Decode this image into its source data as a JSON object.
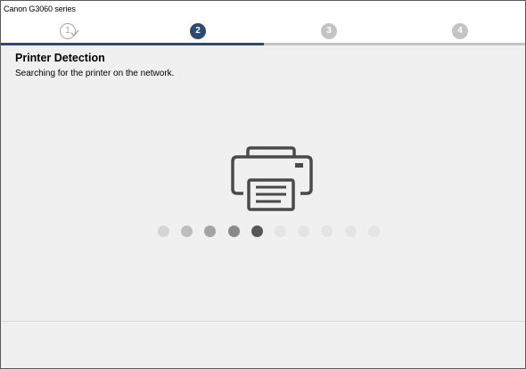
{
  "window": {
    "title": "Canon G3060 series"
  },
  "steps": [
    {
      "label": "1",
      "state": "done",
      "icon": "step-complete-icon"
    },
    {
      "label": "2",
      "state": "current"
    },
    {
      "label": "3",
      "state": "pending"
    },
    {
      "label": "4",
      "state": "pending"
    }
  ],
  "colors": {
    "accent": "#2e4a70",
    "pending": "#c4c4c4",
    "background": "#f0f0f0"
  },
  "main": {
    "heading": "Printer Detection",
    "subtitle": "Searching for the printer on the network.",
    "icon": "printer-icon"
  },
  "progress_dots": {
    "count": 10,
    "colors": [
      "#d4d4d4",
      "#bdbdbd",
      "#a3a3a3",
      "#8a8a8a",
      "#575757",
      "#e4e4e4",
      "#e4e4e4",
      "#e4e4e4",
      "#e4e4e4",
      "#e4e4e4"
    ]
  }
}
